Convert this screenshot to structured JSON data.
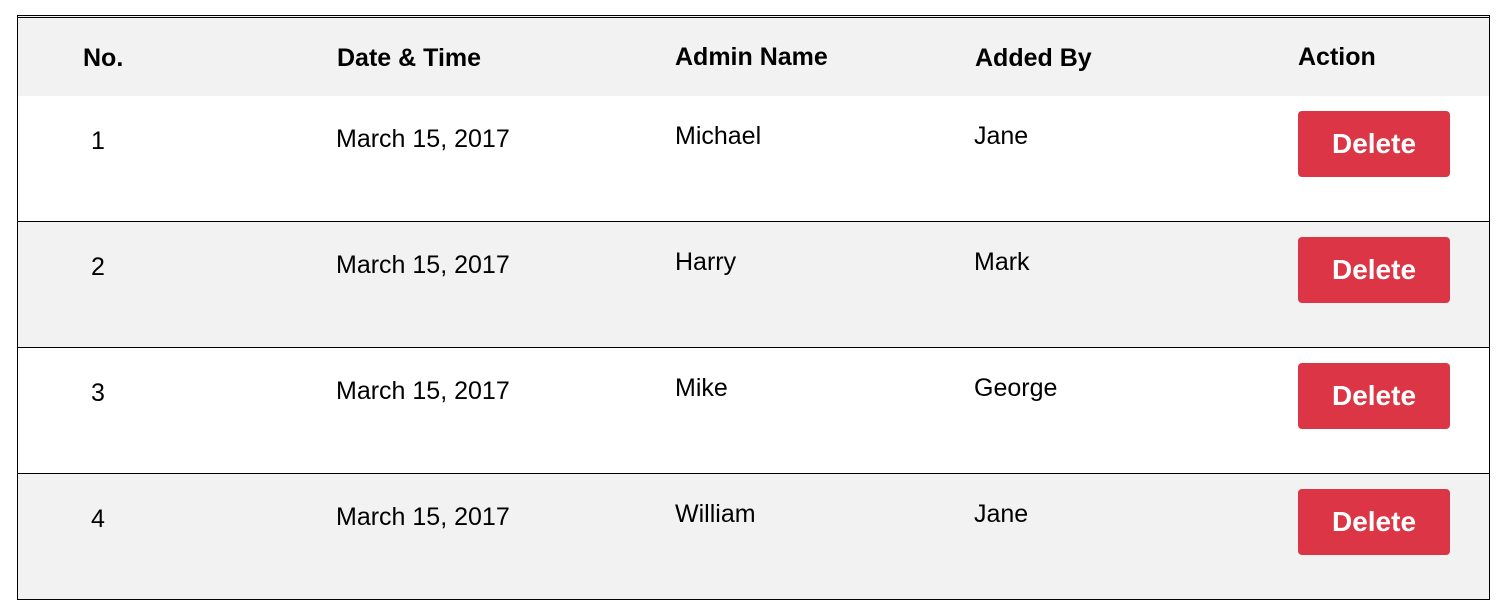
{
  "table": {
    "columns": [
      "No.",
      "Date & Time",
      "Admin Name",
      "Added By",
      "Action"
    ],
    "rows": [
      {
        "no": "1",
        "date": "March 15, 2017",
        "admin": "Michael",
        "added_by": "Jane",
        "action": "Delete"
      },
      {
        "no": "2",
        "date": "March 15, 2017",
        "admin": "Harry",
        "added_by": "Mark",
        "action": "Delete"
      },
      {
        "no": "3",
        "date": "March 15, 2017",
        "admin": "Mike",
        "added_by": "George",
        "action": "Delete"
      },
      {
        "no": "4",
        "date": "March 15, 2017",
        "admin": "William",
        "added_by": "Jane",
        "action": "Delete"
      }
    ]
  },
  "colors": {
    "header_bg": "#f2f2f2",
    "stripe_bg": "#f2f2f2",
    "delete_button": "#dc3545",
    "delete_text": "#ffffff",
    "border": "#000000"
  }
}
